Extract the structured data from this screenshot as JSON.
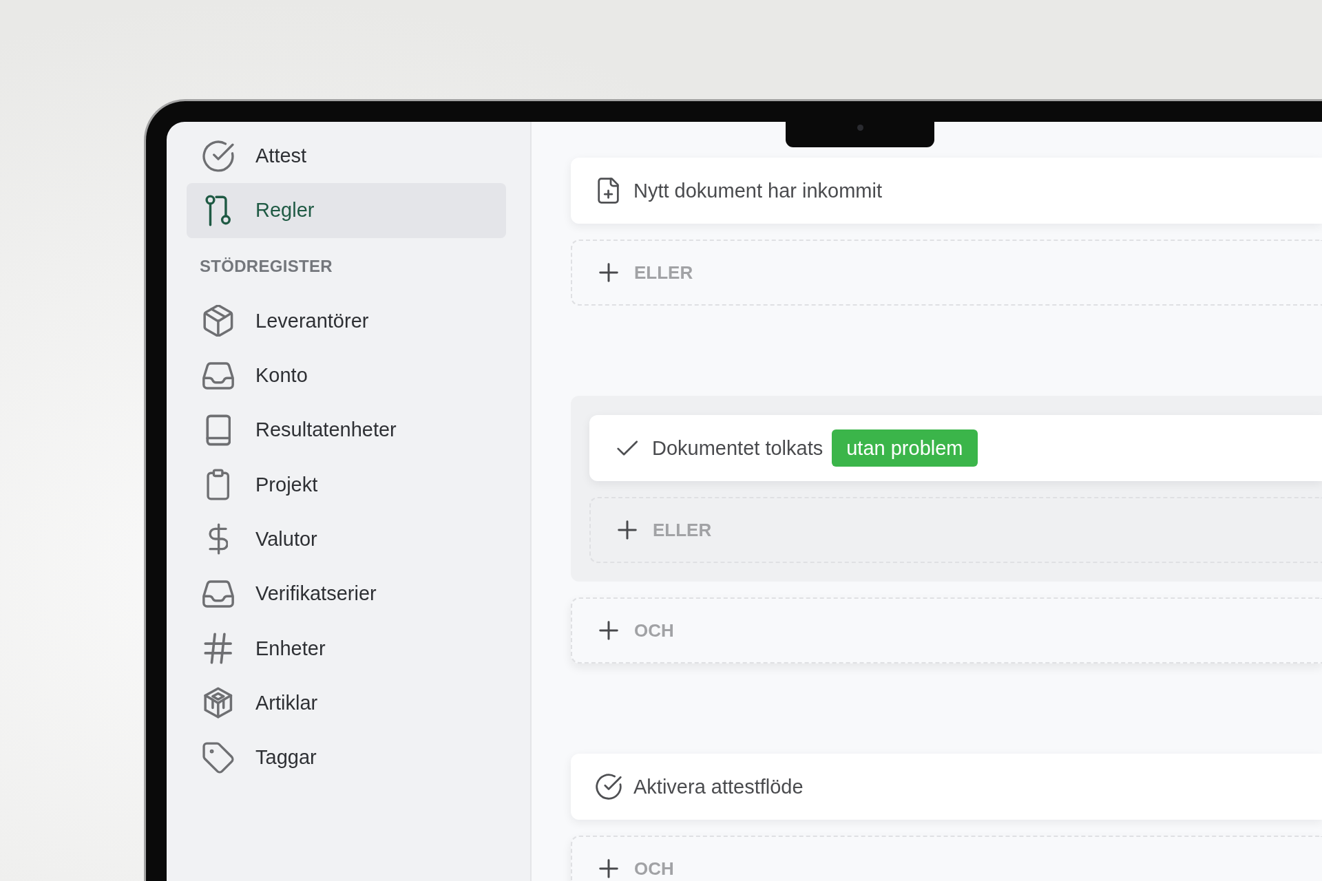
{
  "sidebar": {
    "groups": [
      {
        "items": [
          {
            "label": "Attest",
            "selected": false
          },
          {
            "label": "Regler",
            "selected": true
          }
        ]
      },
      {
        "title": "STÖDREGISTER",
        "items": [
          {
            "label": "Leverantörer",
            "selected": false
          },
          {
            "label": "Konto",
            "selected": false
          },
          {
            "label": "Resultatenheter",
            "selected": false
          },
          {
            "label": "Projekt",
            "selected": false
          },
          {
            "label": "Valutor",
            "selected": false
          },
          {
            "label": "Verifikatserier",
            "selected": false
          },
          {
            "label": "Enheter",
            "selected": false
          },
          {
            "label": "Artiklar",
            "selected": false
          },
          {
            "label": "Taggar",
            "selected": false
          }
        ]
      }
    ]
  },
  "rule": {
    "sections": [
      {
        "items": [
          {
            "kind": "trigger",
            "text": "Nytt dokument har inkommit"
          },
          {
            "kind": "or",
            "label": "ELLER"
          }
        ]
      },
      {
        "items": [
          {
            "kind": "group",
            "items": [
              {
                "kind": "condition",
                "text": "Dokumentet tolkats",
                "badge": "utan problem"
              },
              {
                "kind": "or",
                "label": "ELLER"
              }
            ]
          },
          {
            "kind": "and",
            "label": "OCH"
          }
        ]
      },
      {
        "items": [
          {
            "kind": "action",
            "text": "Aktivera attestflöde"
          },
          {
            "kind": "and",
            "label": "OCH"
          }
        ]
      }
    ]
  }
}
